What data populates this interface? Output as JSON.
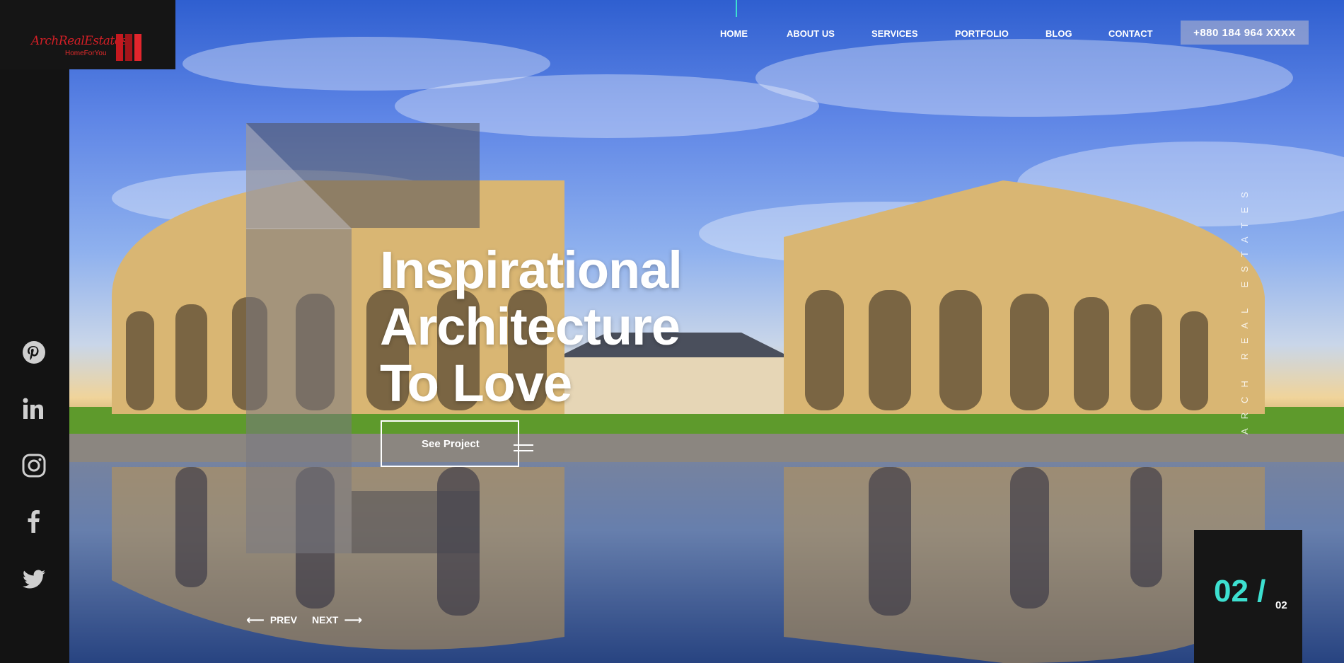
{
  "brand": {
    "logo_text": "ArchRealEstates",
    "logo_tagline": "HomeForYou",
    "vertical_text": "ARCH REAL ESTATES"
  },
  "nav": {
    "items": [
      "HOME",
      "ABOUT US",
      "SERVICES",
      "PORTFOLIO",
      "BLOG",
      "CONTACT"
    ],
    "phone": "+880 184 964 XXXX"
  },
  "hero": {
    "headline_lines": [
      "Inspirational",
      "Architecture",
      "To Love"
    ],
    "cta_label": "See Project",
    "prev_label": "PREV",
    "next_label": "NEXT"
  },
  "slider": {
    "current": "02 /",
    "total": "02"
  },
  "social": [
    "pinterest-icon",
    "linkedin-icon",
    "instagram-icon",
    "facebook-icon",
    "twitter-icon"
  ],
  "colors": {
    "accent": "#3de0d0",
    "brand_red": "#d41f26",
    "sidebar": "#131313"
  }
}
